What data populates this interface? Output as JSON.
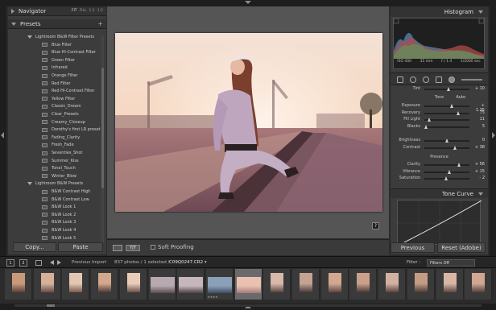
{
  "navigator": {
    "title": "Navigator",
    "zoom_options": [
      "FIT",
      "FILL",
      "1:1",
      "1:2"
    ]
  },
  "presets": {
    "title": "Presets",
    "add_label": "+",
    "folders": [
      {
        "name": "Lightroom B&W Filter Presets",
        "items": [
          "Blue Filter",
          "Blue Hi-Contrast Filter",
          "Green Filter",
          "Infrared",
          "Orange Filter",
          "Red Filter",
          "Red Hi-Contrast Filter",
          "Yellow Filter",
          "Classic_Dream",
          "Clear_Presets",
          "Creamy_Closeup",
          "Dorothy's first LR preset 2",
          "Fading_Clarity",
          "Fresh_Fade",
          "Seventies_Shot",
          "Summer_Kiss",
          "Tonal_Touch",
          "Winter_Blow"
        ]
      },
      {
        "name": "Lightroom B&W Presets",
        "items": [
          "B&W Contrast High",
          "B&W Contrast Low",
          "B&W Look 1",
          "B&W Look 2",
          "B&W Look 3",
          "B&W Look 4",
          "B&W Look 5"
        ]
      }
    ]
  },
  "left_buttons": {
    "copy": "Copy...",
    "paste": "Paste"
  },
  "toolbar": {
    "view_mode": "Y|Y",
    "soft_proofing": "Soft Proofing"
  },
  "help_badge": "?",
  "histogram": {
    "title": "Histogram",
    "iso": "ISO 400",
    "focal": "35 mm",
    "aperture": "f / 1.4",
    "shutter": "1/2000 sec"
  },
  "wb_sliders": [
    {
      "label": "Tint",
      "value": "+ 10",
      "pos": 0.55
    }
  ],
  "tone": {
    "header": "Tone",
    "auto": "Auto",
    "sliders": [
      {
        "label": "Exposure",
        "value": "+ 1.35",
        "pos": 0.62
      },
      {
        "label": "Recovery",
        "value": "75",
        "pos": 0.75
      },
      {
        "label": "Fill Light",
        "value": "11",
        "pos": 0.11
      },
      {
        "label": "Blacks",
        "value": "5",
        "pos": 0.05
      }
    ]
  },
  "tone2": {
    "sliders": [
      {
        "label": "Brightness",
        "value": "0",
        "pos": 0.5
      },
      {
        "label": "Contrast",
        "value": "+ 38",
        "pos": 0.69
      }
    ]
  },
  "presence": {
    "header": "Presence",
    "sliders": [
      {
        "label": "Clarity",
        "value": "+ 56",
        "pos": 0.78
      },
      {
        "label": "Vibrance",
        "value": "+ 15",
        "pos": 0.57
      },
      {
        "label": "Saturation",
        "value": "- 2",
        "pos": 0.49
      }
    ]
  },
  "tone_curve": {
    "title": "Tone Curve"
  },
  "right_buttons": {
    "previous": "Previous",
    "reset": "Reset (Adobe)"
  },
  "filmbar": {
    "page1": "1",
    "page2": "2",
    "source": "Previous Import",
    "count": "837 photos / 1 selected /",
    "filename": "C09Q0247.CR2",
    "filter_label": "Filter :",
    "filter_value": "Filters Off"
  },
  "filmstrip": {
    "selected_index": 8,
    "stars": "★★★★"
  },
  "colors": {
    "panel_bg": "#3c3c3c",
    "center_bg": "#555555",
    "selected_thumb": "#6a6a6a"
  }
}
